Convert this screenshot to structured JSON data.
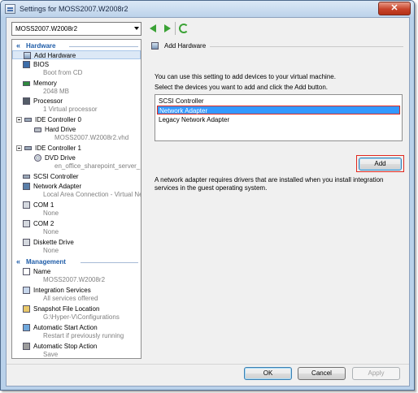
{
  "window": {
    "title": "Settings for MOSS2007.W2008r2",
    "close_glyph": "✕"
  },
  "vm_selector": {
    "value": "MOSS2007.W2008r2"
  },
  "toolbar": {
    "back": "back-arrow-icon",
    "forward": "forward-arrow-icon",
    "refresh": "refresh-icon"
  },
  "tree": {
    "hardware_header": "Hardware",
    "management_header": "Management",
    "chevron": "«",
    "items": [
      {
        "label": "Add Hardware",
        "sub": ""
      },
      {
        "label": "BIOS",
        "sub": "Boot from CD"
      },
      {
        "label": "Memory",
        "sub": "2048 MB"
      },
      {
        "label": "Processor",
        "sub": "1 Virtual processor"
      },
      {
        "label": "IDE Controller 0",
        "sub": ""
      },
      {
        "label": "Hard Drive",
        "sub": "MOSS2007.W2008r2.vhd"
      },
      {
        "label": "IDE Controller 1",
        "sub": ""
      },
      {
        "label": "DVD Drive",
        "sub": "en_office_sharepoint_server_..."
      },
      {
        "label": "SCSI Controller",
        "sub": ""
      },
      {
        "label": "Network Adapter",
        "sub": "Local Area Connection - Virtual Net..."
      },
      {
        "label": "COM 1",
        "sub": "None"
      },
      {
        "label": "COM 2",
        "sub": "None"
      },
      {
        "label": "Diskette Drive",
        "sub": "None"
      },
      {
        "label": "Name",
        "sub": "MOSS2007.W2008r2"
      },
      {
        "label": "Integration Services",
        "sub": "All services offered"
      },
      {
        "label": "Snapshot File Location",
        "sub": "G:\\Hyper-V\\Configurations"
      },
      {
        "label": "Automatic Start Action",
        "sub": "Restart if previously running"
      },
      {
        "label": "Automatic Stop Action",
        "sub": "Save"
      }
    ]
  },
  "panel": {
    "group_title": "Add Hardware",
    "intro": "You can use this setting to add devices to your virtual machine.",
    "instruction": "Select the devices you want to add and click the Add button.",
    "devices": [
      "SCSI Controller",
      "Network Adapter",
      "Legacy Network Adapter"
    ],
    "selected_device": "Network Adapter",
    "add_button": "Add",
    "note_line1": "A network adapter requires drivers that are installed when you install integration",
    "note_line2": "services in the guest operating system."
  },
  "footer": {
    "ok": "OK",
    "cancel": "Cancel",
    "apply": "Apply"
  },
  "colors": {
    "selection": "#3399ff",
    "highlight_box": "#e0281e",
    "section_header": "#1e5ca8"
  }
}
